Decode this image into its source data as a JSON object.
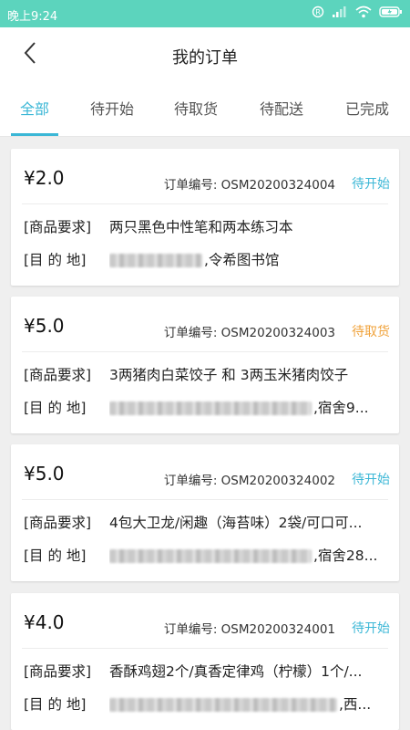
{
  "status_bar": {
    "time": "晚上9:24",
    "icons": [
      "alarm-icon",
      "signal-icon",
      "wifi-icon",
      "battery-icon"
    ]
  },
  "header": {
    "title": "我的订单",
    "back_icon": "chevron-left-icon"
  },
  "tabs": [
    {
      "label": "全部",
      "active": true
    },
    {
      "label": "待开始",
      "active": false
    },
    {
      "label": "待取货",
      "active": false
    },
    {
      "label": "待配送",
      "active": false
    },
    {
      "label": "已完成",
      "active": false
    }
  ],
  "colors": {
    "accent": "#3bb7d6",
    "status_bar": "#5cd4bd",
    "status_pending_start": "#3bb7d6",
    "status_pending_pickup": "#f0a23a"
  },
  "labels": {
    "goods": "[商品要求]",
    "destination": "[目  的  地]",
    "order_no_prefix": "订单编号:"
  },
  "orders": [
    {
      "price": "¥2.0",
      "order_no": "订单编号:  OSM20200324004",
      "status": "待开始",
      "goods": "两只黑色中性笔和两本练习本",
      "destination_visible": ",令希图书馆"
    },
    {
      "price": "¥5.0",
      "order_no": "订单编号:  OSM20200324003",
      "status": "待取货",
      "goods": "3两猪肉白菜饺子 和 3两玉米猪肉饺子",
      "destination_visible": ",宿舍9..."
    },
    {
      "price": "¥5.0",
      "order_no": "订单编号:  OSM20200324002",
      "status": "待开始",
      "goods": "4包大卫龙/闲趣（海苔味）2袋/可口可...",
      "destination_visible": ",宿舍28..."
    },
    {
      "price": "¥4.0",
      "order_no": "订单编号:  OSM20200324001",
      "status": "待开始",
      "goods": "香酥鸡翅2个/真香定律鸡（柠檬）1个/...",
      "destination_visible": ",西..."
    }
  ]
}
